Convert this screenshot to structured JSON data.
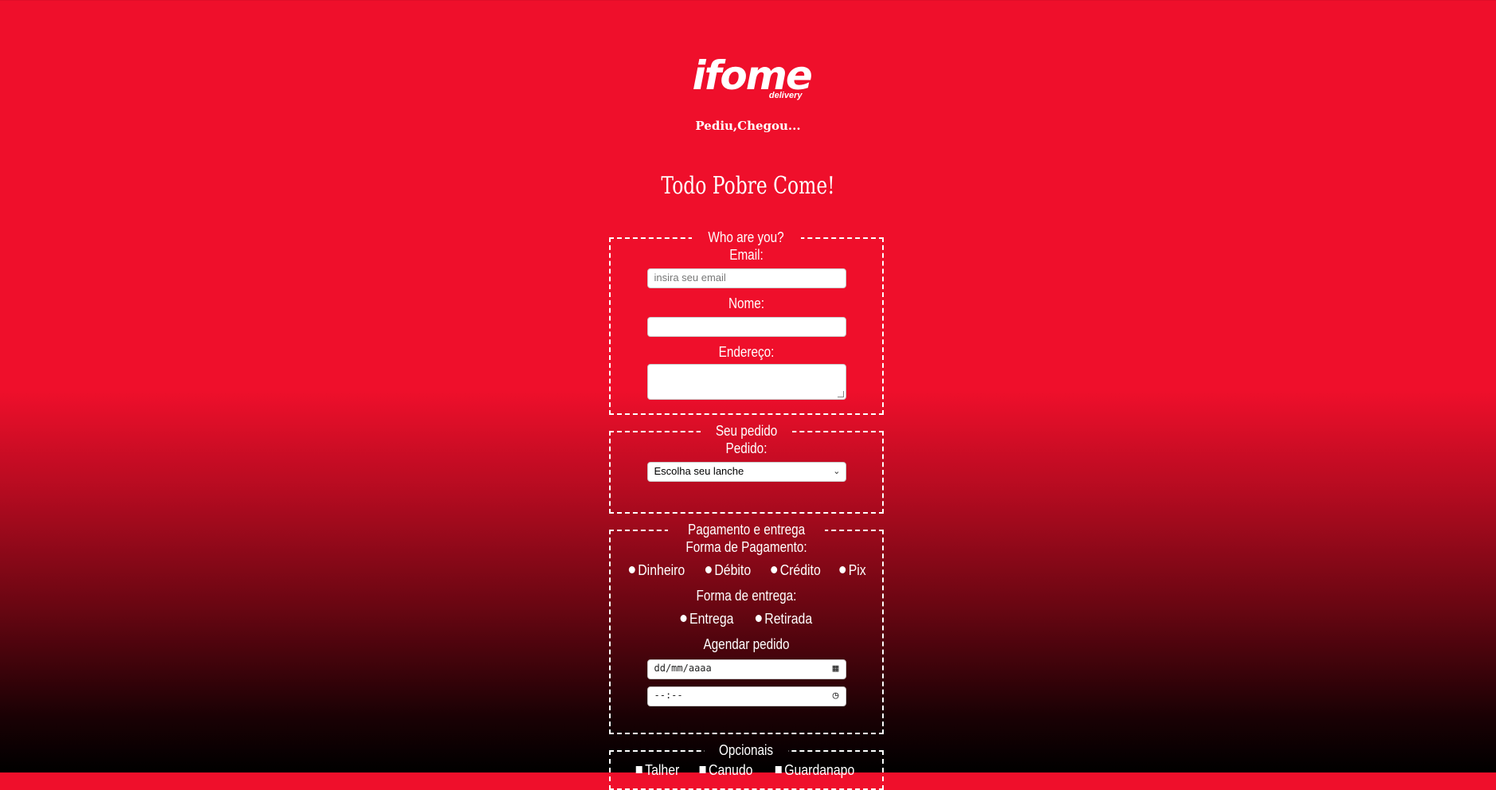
{
  "brand": {
    "logo_text": "ifome",
    "logo_sub": "delivery",
    "slogan": "Pediu,Chegou..."
  },
  "title": "Todo Pobre Come!",
  "who": {
    "legend": "Who are you?",
    "email_label": "Email:",
    "email_placeholder": "insira seu email",
    "name_label": "Nome:",
    "address_label": "Endereço:"
  },
  "order": {
    "legend": "Seu pedido",
    "label": "Pedido:",
    "select_value": "Escolha seu lanche"
  },
  "payment": {
    "legend": "Pagamento e entrega",
    "method_label": "Forma de Pagamento:",
    "methods": [
      "Dinheiro",
      "Débito",
      "Crédito",
      "Pix"
    ],
    "delivery_label": "Forma de entrega:",
    "delivery_options": [
      "Entrega",
      "Retirada"
    ],
    "schedule_label": "Agendar pedido",
    "date_placeholder": "dd/mm/aaaa",
    "time_placeholder": "--:--"
  },
  "optionals": {
    "legend": "Opcionais",
    "items": [
      "Talher",
      "Canudo",
      "Guardanapo"
    ]
  },
  "icons": {
    "calendar": "calendar-icon",
    "clock": "clock-icon",
    "chevron": "chevron-down-icon"
  }
}
